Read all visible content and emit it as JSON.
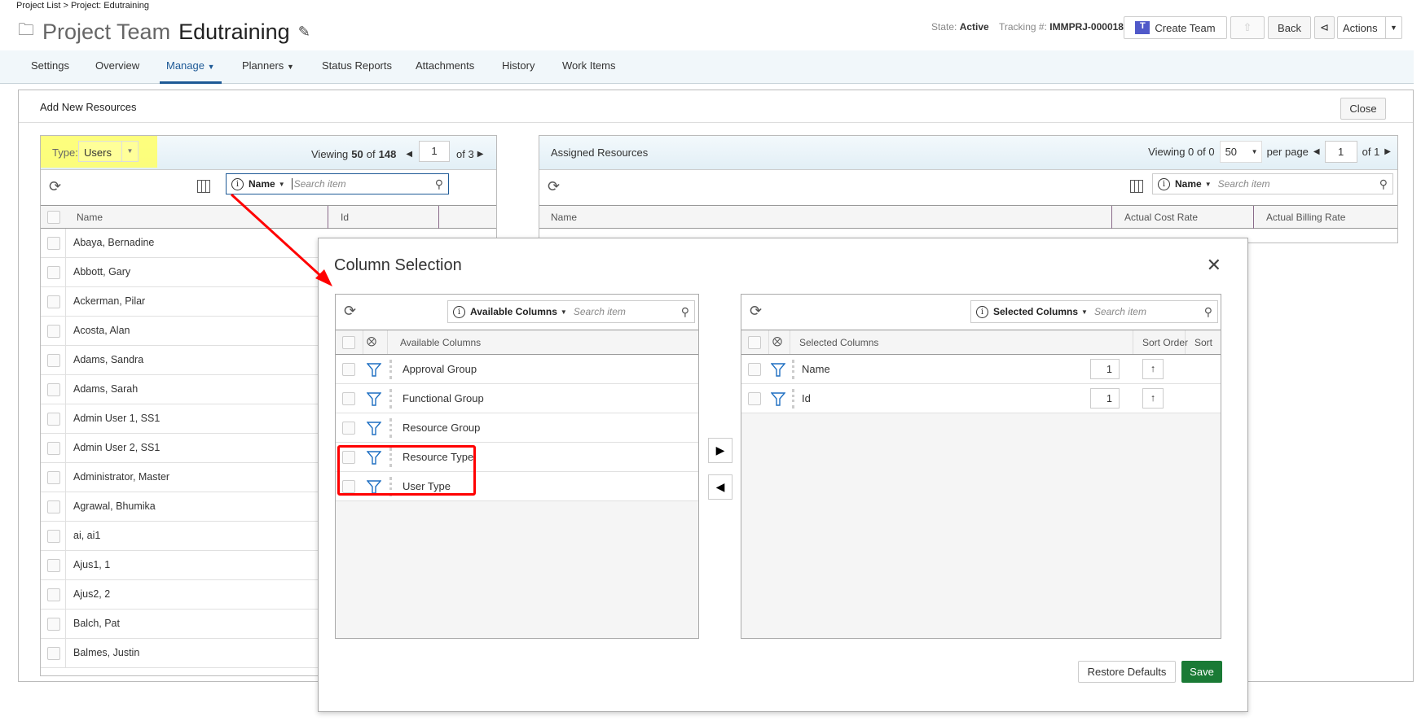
{
  "breadcrumb": "Project List > Project: Edutraining",
  "header": {
    "title_prefix": "Project Team",
    "title_name": "Edutraining",
    "state_label": "State:",
    "state_value": "Active",
    "tracking_label": "Tracking #:",
    "tracking_value": "IMMPRJ-000018",
    "create_team": "Create Team",
    "back": "Back",
    "actions": "Actions"
  },
  "nav": {
    "tabs": [
      "Settings",
      "Overview",
      "Manage",
      "Planners",
      "Status Reports",
      "Attachments",
      "History",
      "Work Items"
    ],
    "active": "Manage"
  },
  "panel": {
    "title": "Add New Resources",
    "close": "Close"
  },
  "left_grid": {
    "type_label": "Type:",
    "type_value": "Users",
    "viewing": "Viewing",
    "shown": "50",
    "of": "of",
    "total": "148",
    "page": "1",
    "of_pages": "of 3",
    "search_field": "Name",
    "search_placeholder": "Search item",
    "col_name": "Name",
    "col_id": "Id",
    "rows": [
      "Abaya, Bernadine",
      "Abbott, Gary",
      "Ackerman, Pilar",
      "Acosta, Alan",
      "Adams, Sandra",
      "Adams, Sarah",
      "Admin User 1, SS1",
      "Admin User 2, SS1",
      "Administrator, Master",
      "Agrawal, Bhumika",
      "ai, ai1",
      "Ajus1, 1",
      "Ajus2, 2",
      "Balch, Pat",
      "Balmes, Justin"
    ]
  },
  "right_grid": {
    "title": "Assigned Resources",
    "viewing": "Viewing 0 of 0",
    "per_page_value": "50",
    "per_page": "per page",
    "page": "1",
    "of_pages": "of 1",
    "search_field": "Name",
    "search_placeholder": "Search item",
    "cols": [
      "Name",
      "Actual Cost Rate",
      "Actual Billing Rate"
    ]
  },
  "dialog": {
    "title": "Column Selection",
    "available": {
      "search_field": "Available Columns",
      "search_placeholder": "Search item",
      "header": "Available Columns",
      "items": [
        "Approval Group",
        "Functional Group",
        "Resource Group",
        "Resource Type",
        "User Type"
      ]
    },
    "selected": {
      "search_field": "Selected Columns",
      "search_placeholder": "Search item",
      "header": "Selected Columns",
      "sort_order": "Sort Order",
      "sort": "Sort",
      "items": [
        {
          "name": "Name",
          "order": "1"
        },
        {
          "name": "Id",
          "order": "1"
        }
      ]
    },
    "restore": "Restore Defaults",
    "save": "Save"
  },
  "colors": {
    "accent": "#1e5a96",
    "save": "#1a7a35",
    "highlight": "#ffff66",
    "annotation": "#ff0000"
  }
}
